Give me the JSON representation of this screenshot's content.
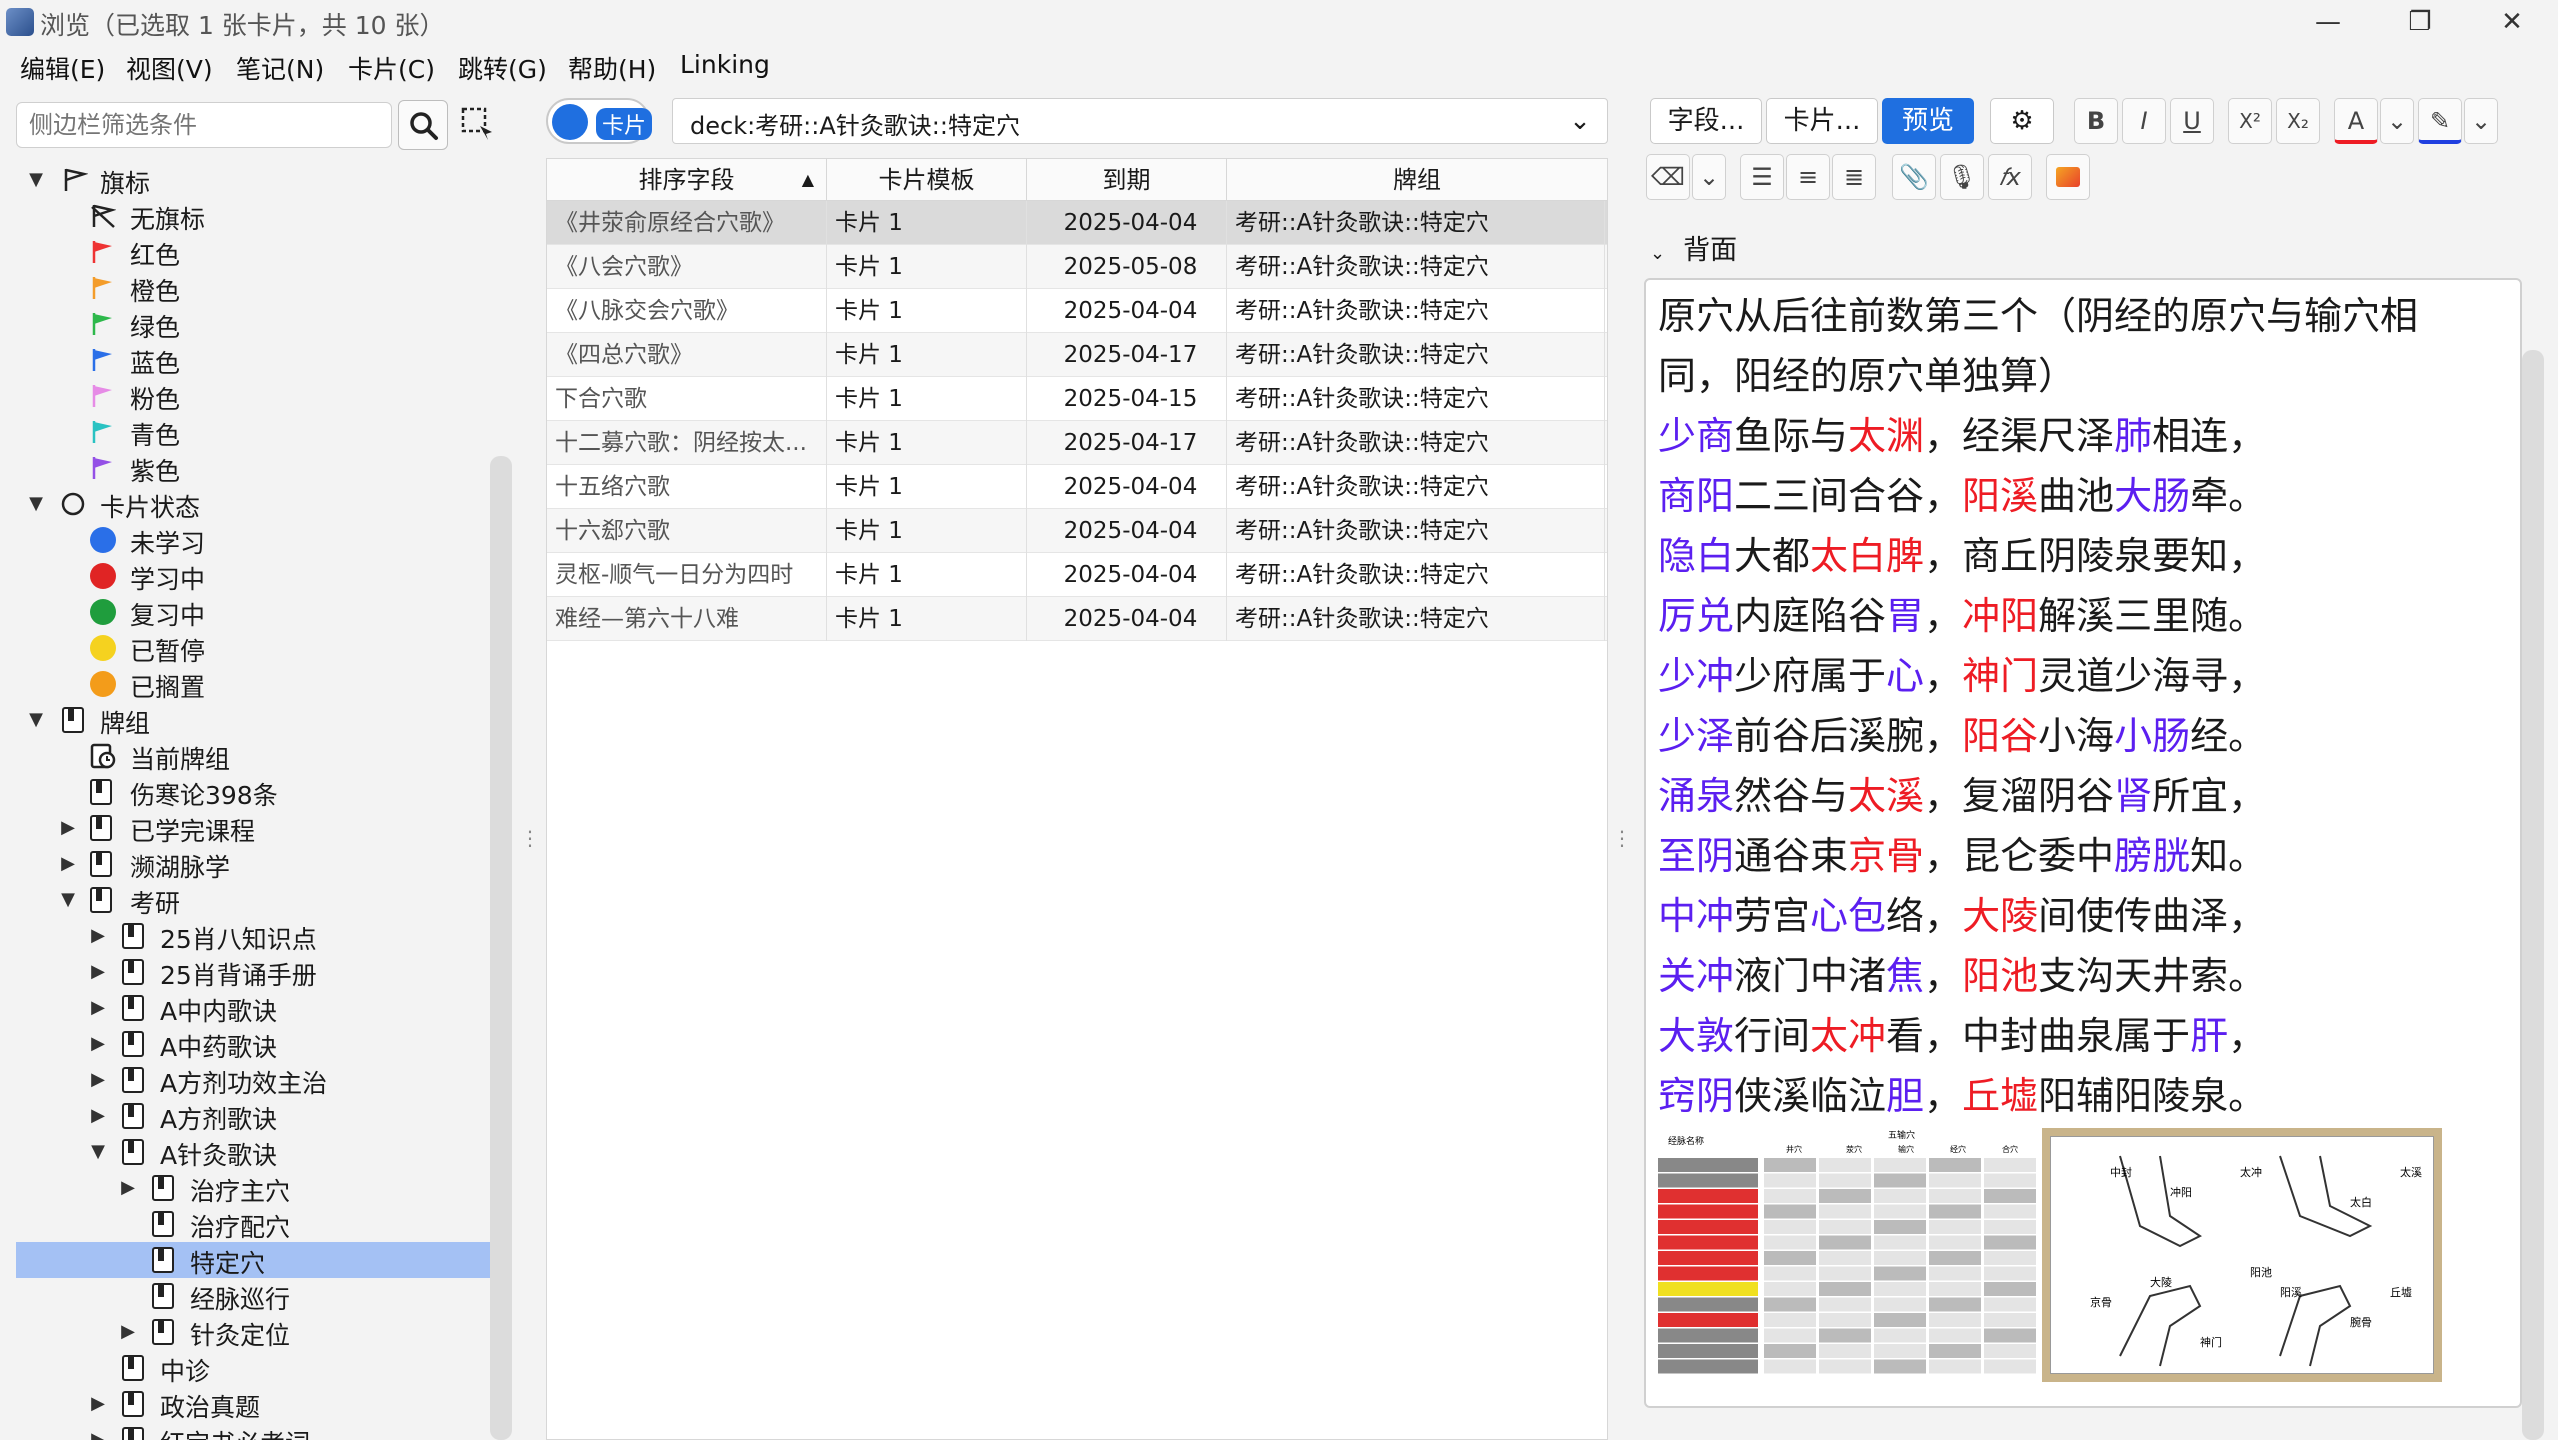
{
  "window": {
    "title": "浏览（已选取 1 张卡片，共 10 张）",
    "controls": [
      "—",
      "❐",
      "✕"
    ]
  },
  "menu": [
    "编辑(E)",
    "视图(V)",
    "笔记(N)",
    "卡片(C)",
    "跳转(G)",
    "帮助(H)",
    "Linking"
  ],
  "sidebar": {
    "search_placeholder": "侧边栏筛选条件",
    "flags_header": "旗标",
    "flags": [
      {
        "label": "无旗标",
        "color": "#222222"
      },
      {
        "label": "红色",
        "color": "#ee3333"
      },
      {
        "label": "橙色",
        "color": "#f39c2a"
      },
      {
        "label": "绿色",
        "color": "#2db84b"
      },
      {
        "label": "蓝色",
        "color": "#2a6fe8"
      },
      {
        "label": "粉色",
        "color": "#e68be6"
      },
      {
        "label": "青色",
        "color": "#29c2c2"
      },
      {
        "label": "紫色",
        "color": "#9450e6"
      }
    ],
    "status_header": "卡片状态",
    "statuses": [
      {
        "label": "未学习",
        "color": "#2a6fe8"
      },
      {
        "label": "学习中",
        "color": "#e02424"
      },
      {
        "label": "复习中",
        "color": "#1f9d3d"
      },
      {
        "label": "已暂停",
        "color": "#f5d21f"
      },
      {
        "label": "已搁置",
        "color": "#f39c1a"
      }
    ],
    "decks_header": "牌组",
    "decks": [
      "当前牌组",
      "伤寒论398条",
      "已学完课程",
      "濒湖脉学",
      "考研",
      "25肖八知识点",
      "25肖背诵手册",
      "A中内歌诀",
      "A中药歌诀",
      "A方剂功效主治",
      "A方剂歌诀",
      "A针灸歌诀",
      "治疗主穴",
      "治疗配穴",
      "特定穴",
      "经脉巡行",
      "针灸定位",
      "中诊",
      "政治真题",
      "红宝书必考词"
    ]
  },
  "toggle_label": "卡片",
  "search_query": "deck:考研::A针灸歌诀::特定穴",
  "table": {
    "columns": [
      "排序字段",
      "卡片模板",
      "到期",
      "牌组"
    ],
    "rows": [
      [
        "《井荥俞原经合穴歌》",
        "卡片 1",
        "2025-04-04",
        "考研::A针灸歌诀::特定穴"
      ],
      [
        "《八会穴歌》",
        "卡片 1",
        "2025-05-08",
        "考研::A针灸歌诀::特定穴"
      ],
      [
        "《八脉交会穴歌》",
        "卡片 1",
        "2025-04-04",
        "考研::A针灸歌诀::特定穴"
      ],
      [
        "《四总穴歌》",
        "卡片 1",
        "2025-04-17",
        "考研::A针灸歌诀::特定穴"
      ],
      [
        "下合穴歌",
        "卡片 1",
        "2025-04-15",
        "考研::A针灸歌诀::特定穴"
      ],
      [
        "十二募穴歌：阴经按太...",
        "卡片 1",
        "2025-04-17",
        "考研::A针灸歌诀::特定穴"
      ],
      [
        "十五络穴歌",
        "卡片 1",
        "2025-04-04",
        "考研::A针灸歌诀::特定穴"
      ],
      [
        "十六郄穴歌",
        "卡片 1",
        "2025-04-04",
        "考研::A针灸歌诀::特定穴"
      ],
      [
        "灵枢-顺气一日分为四时",
        "卡片 1",
        "2025-04-04",
        "考研::A针灸歌诀::特定穴"
      ],
      [
        "难经—第六十八难",
        "卡片 1",
        "2025-04-04",
        "考研::A针灸歌诀::特定穴"
      ]
    ]
  },
  "editor": {
    "buttons": {
      "fields": "字段...",
      "cards": "卡片...",
      "preview": "预览"
    },
    "format": {
      "bold": "B",
      "italic": "I",
      "underline": "U",
      "sup": "X²",
      "sub": "X₂",
      "color": "A",
      "clip": "📎",
      "mic": "🎙",
      "fx": "𝑓x"
    },
    "field_name": "背面",
    "intro_lines": [
      "原穴从后往前数第三个（阴经的原穴与输穴相",
      "同，阳经的原穴单独算）"
    ],
    "verses": [
      [
        [
          "少商",
          "p"
        ],
        [
          "鱼际与",
          ""
        ],
        [
          "太渊",
          "r"
        ],
        [
          "，经渠尺泽",
          ""
        ],
        [
          "肺",
          "p"
        ],
        [
          "相连，",
          ""
        ]
      ],
      [
        [
          "商阳",
          "p"
        ],
        [
          "二三间合谷，",
          ""
        ],
        [
          "阳溪",
          "r"
        ],
        [
          "曲池",
          ""
        ],
        [
          "大肠",
          "p"
        ],
        [
          "牵。",
          ""
        ]
      ],
      [
        [
          "隐白",
          "p"
        ],
        [
          "大都",
          ""
        ],
        [
          "太白",
          "r"
        ],
        [
          "脾",
          "r"
        ],
        [
          "，商丘阴陵泉要知，",
          ""
        ]
      ],
      [
        [
          "厉兑",
          "p"
        ],
        [
          "内庭陷谷",
          ""
        ],
        [
          "胃",
          "p"
        ],
        [
          "，",
          ""
        ],
        [
          "冲阳",
          "r"
        ],
        [
          "解溪三里随。",
          ""
        ]
      ],
      [
        [
          "少冲",
          "p"
        ],
        [
          "少府属于",
          ""
        ],
        [
          "心",
          "p"
        ],
        [
          "，",
          ""
        ],
        [
          "神门",
          "r"
        ],
        [
          "灵道少海寻，",
          ""
        ]
      ],
      [
        [
          "少泽",
          "p"
        ],
        [
          "前谷后溪腕，",
          ""
        ],
        [
          "阳谷",
          "r"
        ],
        [
          "小海",
          ""
        ],
        [
          "小肠",
          "p"
        ],
        [
          "经。",
          ""
        ]
      ],
      [
        [
          "涌泉",
          "p"
        ],
        [
          "然谷与",
          ""
        ],
        [
          "太溪",
          "r"
        ],
        [
          "，复溜阴谷",
          ""
        ],
        [
          "肾",
          "p"
        ],
        [
          "所宜，",
          ""
        ]
      ],
      [
        [
          "至阴",
          "p"
        ],
        [
          "通谷束",
          ""
        ],
        [
          "京骨",
          "r"
        ],
        [
          "，昆仑委中",
          ""
        ],
        [
          "膀胱",
          "p"
        ],
        [
          "知。",
          ""
        ]
      ],
      [
        [
          "中冲",
          "p"
        ],
        [
          "劳宫",
          ""
        ],
        [
          "心包",
          "p"
        ],
        [
          "络，",
          ""
        ],
        [
          "大陵",
          "r"
        ],
        [
          "间使传曲泽，",
          ""
        ]
      ],
      [
        [
          "关冲",
          "p"
        ],
        [
          "液门中渚",
          ""
        ],
        [
          "焦",
          "p"
        ],
        [
          "，",
          ""
        ],
        [
          "阳池",
          "r"
        ],
        [
          "支沟天井索。",
          ""
        ]
      ],
      [
        [
          "大敦",
          "p"
        ],
        [
          "行间",
          ""
        ],
        [
          "太冲",
          "r"
        ],
        [
          "看，中封曲泉属于",
          ""
        ],
        [
          "肝",
          "p"
        ],
        [
          "，",
          ""
        ]
      ],
      [
        [
          "窍阴",
          "p"
        ],
        [
          "侠溪临泣",
          ""
        ],
        [
          "胆",
          "p"
        ],
        [
          "，",
          ""
        ],
        [
          "丘墟",
          "r"
        ],
        [
          "阳辅阳陵泉。",
          ""
        ]
      ]
    ],
    "acu_table_headers": [
      "经脉名称",
      "五输穴",
      "井穴",
      "荥穴",
      "输穴",
      "经穴",
      "合穴"
    ],
    "figure_labels": [
      "中封",
      "太冲",
      "太溪",
      "太白",
      "大陵",
      "神门",
      "阳池",
      "阳溪",
      "丘墟",
      "冲阳",
      "京骨",
      "腕骨"
    ]
  }
}
